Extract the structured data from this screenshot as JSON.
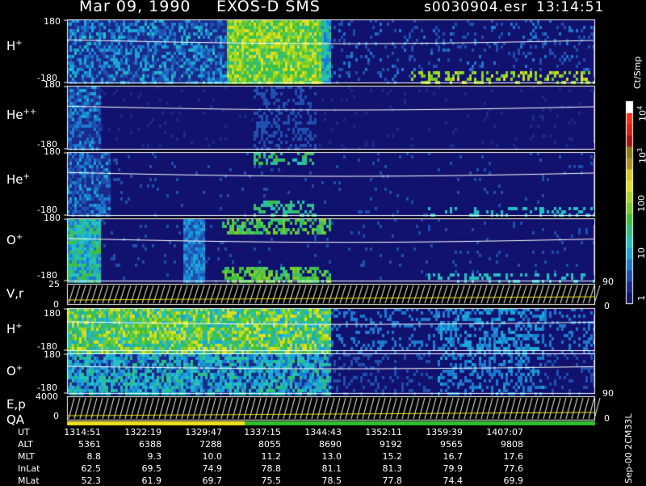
{
  "header": {
    "date": "Mar 09, 1990",
    "mission": "EXOS-D SMS",
    "file": "s0030904.esr",
    "time": "13:14:51"
  },
  "colors": {
    "background": "#000000",
    "low": "#11116e",
    "frame": "#ffffff",
    "bar_yellow": "#f0e020",
    "bar_green": "#30c030"
  },
  "colorbar": {
    "unit_label": "Ct/Smp",
    "ticks": [
      {
        "label": "1",
        "value": 1
      },
      {
        "label": "10",
        "value": 10
      },
      {
        "label": "100",
        "value": 100
      },
      {
        "label": "10^3",
        "value": 1000
      },
      {
        "label": "10^4",
        "value": 10000
      }
    ],
    "colors": [
      "#11116e",
      "#1a2a8a",
      "#1f4fb0",
      "#1c7ad0",
      "#19a6d8",
      "#25c0c0",
      "#2fc080",
      "#3fbf3f",
      "#78cc2a",
      "#a8d820",
      "#dde020",
      "#d8c818",
      "#b09018",
      "#8a7a10",
      "#b01010",
      "#e02010",
      "#ff3010",
      "#ffffff"
    ]
  },
  "footer": {
    "rows": [
      {
        "name": "UT",
        "values": [
          "1314:51",
          "1322:19",
          "1329:47",
          "1337:15",
          "1344:43",
          "1352:11",
          "1359:39",
          "1407:07"
        ]
      },
      {
        "name": "ALT",
        "values": [
          "5361",
          "6388",
          "7288",
          "8055",
          "8690",
          "9192",
          "9565",
          "9808"
        ]
      },
      {
        "name": "MLT",
        "values": [
          "8.8",
          "9.3",
          "10.0",
          "11.2",
          "13.0",
          "15.2",
          "16.7",
          "17.6"
        ]
      },
      {
        "name": "InLat",
        "values": [
          "62.5",
          "69.5",
          "74.9",
          "78.8",
          "81.1",
          "81.3",
          "79.9",
          "77.6"
        ]
      },
      {
        "name": "MLat",
        "values": [
          "52.3",
          "61.9",
          "69.7",
          "75.5",
          "78.5",
          "77.8",
          "74.4",
          "69.9"
        ]
      }
    ],
    "side_note": "Sep-00 2CM33L"
  },
  "chart_data": {
    "type": "heatmap",
    "title": "Mar 09, 1990   EXOS-D SMS",
    "x_axis": {
      "name": "UT",
      "ticks": [
        "1314:51",
        "1322:19",
        "1329:47",
        "1337:15",
        "1344:43",
        "1352:11",
        "1359:39",
        "1407:07"
      ]
    },
    "colorbar_range": [
      1,
      10000
    ],
    "colorbar_scale": "log",
    "panels": [
      {
        "label": "H+",
        "y_ticks": [
          "180",
          "-180"
        ],
        "ylim": [
          -180,
          180
        ]
      },
      {
        "label": "He++",
        "y_ticks": [
          "180",
          "-180"
        ],
        "ylim": [
          -180,
          180
        ]
      },
      {
        "label": "He+",
        "y_ticks": [
          "180",
          "-180"
        ],
        "ylim": [
          -180,
          180
        ]
      },
      {
        "label": "O+",
        "y_ticks": [
          "180",
          "-180"
        ],
        "ylim": [
          -180,
          180
        ]
      },
      {
        "label": "V,r",
        "y_ticks": [
          "25",
          "0"
        ],
        "right_ticks": [
          "90",
          "0"
        ]
      },
      {
        "label": "H+",
        "y_ticks": [
          "180",
          "-180"
        ],
        "ylim": [
          -180,
          180
        ]
      },
      {
        "label": "O+",
        "y_ticks": [
          "180",
          "-180"
        ],
        "ylim": [
          -180,
          180
        ]
      },
      {
        "label": "E,p",
        "label2": "QA",
        "y_ticks": [
          "4000",
          "0"
        ],
        "right_ticks": [
          "90",
          "0"
        ]
      }
    ]
  }
}
